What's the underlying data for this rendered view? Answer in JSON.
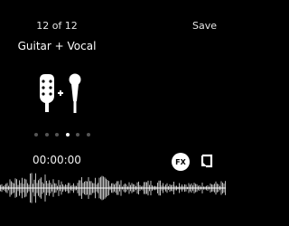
{
  "header": {
    "counter": "12 of 12",
    "save_label": "Save"
  },
  "preset": {
    "name": "Guitar + Vocal",
    "icon": "guitar-plus-microphone-icon"
  },
  "pager": {
    "count": 6,
    "active_index": 3
  },
  "transport": {
    "time": "00:00:00",
    "fx_label": "FX",
    "loop_icon": "loop-icon"
  },
  "colors": {
    "background": "#000000",
    "text": "#ffffff",
    "waveform": "#bdbdbd",
    "inactive_dot": "#555555"
  }
}
